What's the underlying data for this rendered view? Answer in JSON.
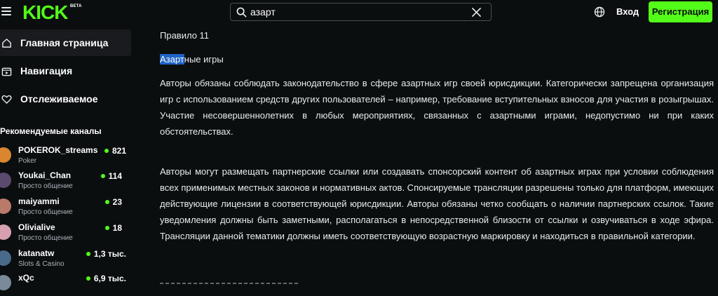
{
  "header": {
    "logo_text": "KICK",
    "beta_badge": "BETA",
    "search": {
      "value": "азарт",
      "placeholder": ""
    },
    "login_label": "Вход",
    "register_label": "Регистрация",
    "accent_color": "#53fc18"
  },
  "sidebar": {
    "nav": [
      {
        "label": "Главная страница",
        "icon": "home-icon"
      },
      {
        "label": "Навигация",
        "icon": "browse-icon"
      },
      {
        "label": "Отслеживаемое",
        "icon": "heart-icon"
      }
    ],
    "recommended_title": "Рекомендуемые каналы",
    "channels": [
      {
        "name": "POKEROK_streams",
        "category": "Poker",
        "viewers": "821",
        "avatar_color": "#d9862e"
      },
      {
        "name": "Youkai_Chan",
        "category": "Просто общение",
        "viewers": "114",
        "avatar_color": "#5a4a6e"
      },
      {
        "name": "maiyammi",
        "category": "Просто общение",
        "viewers": "23",
        "avatar_color": "#b97a6a"
      },
      {
        "name": "Olivialive",
        "category": "Просто общение",
        "viewers": "18",
        "avatar_color": "#d6a0b0"
      },
      {
        "name": "katanatw",
        "category": "Slots & Casino",
        "viewers": "1,3 тыс.",
        "avatar_color": "#4a6a8a"
      },
      {
        "name": "xQc",
        "category": "",
        "viewers": "6,9 тыс.",
        "avatar_color": "#7a8a9a"
      }
    ]
  },
  "main": {
    "rule_title": "Правило 11",
    "heading_highlight": "Азарт",
    "heading_rest": "ные игры",
    "paragraph1": "Авторы обязаны соблюдать законодательство в сфере азартных игр своей юрисдикции. Категорически запрещена организация игр с использованием средств других пользователей – например, требование вступительных взносов для участия в розыгрышах. Участие несовершеннолетних в любых мероприятиях, связанных с азартными играми, недопустимо ни при каких обстоятельствах.",
    "paragraph2": "Авторы могут размещать партнерские ссылки или создавать спонсорский контент об азартных играх при условии соблюдения всех применимых местных законов и нормативных актов. Спонсируемые трансляции разрешены только для платформ, имеющих действующие лицензии в соответствующей юрисдикции. Авторы обязаны четко сообщать о наличии партнерских ссылок. Такие уведомления должны быть заметными, располагаться в непосредственной близости от ссылки и озвучиваться в ходе эфира. Трансляции данной тематики должны иметь соответствующую возрастную маркировку и находиться в правильной категории."
  }
}
